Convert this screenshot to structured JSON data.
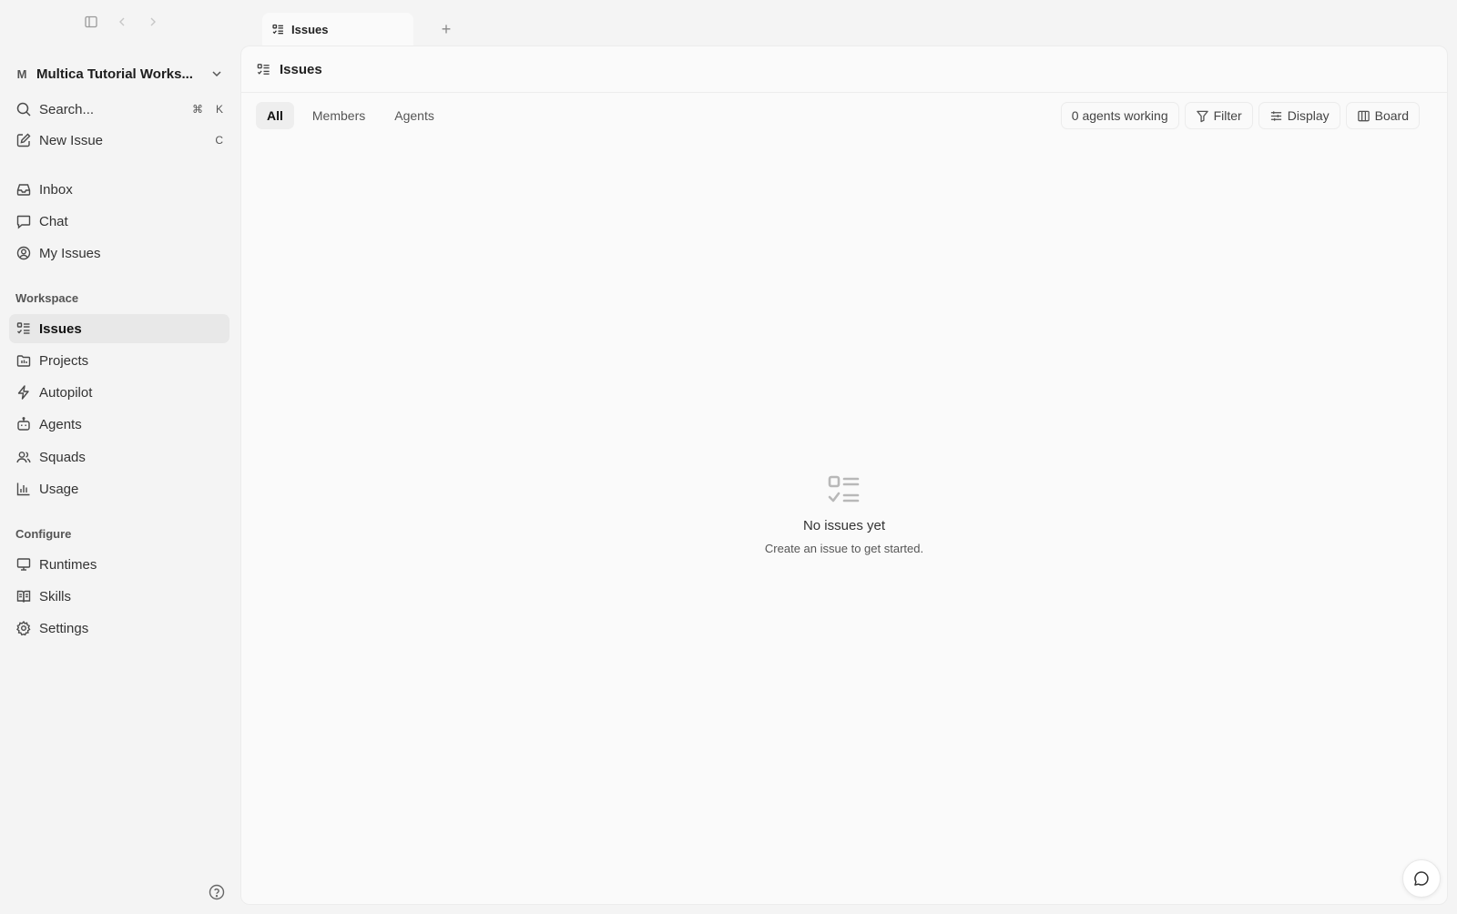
{
  "tabs": [
    {
      "label": "Issues",
      "icon": "issues-list-icon"
    }
  ],
  "sidebar": {
    "workspace": {
      "initial": "M",
      "name": "Multica Tutorial Works..."
    },
    "search": {
      "label": "Search...",
      "shortcut_mod": "⌘",
      "shortcut_key": "K"
    },
    "new_issue": {
      "label": "New Issue",
      "shortcut": "C"
    },
    "primary": [
      {
        "label": "Inbox",
        "icon": "inbox-icon"
      },
      {
        "label": "Chat",
        "icon": "chat-bubble-icon"
      },
      {
        "label": "My Issues",
        "icon": "user-circle-icon"
      }
    ],
    "workspace_section": {
      "label": "Workspace",
      "items": [
        {
          "label": "Issues",
          "icon": "issues-list-icon",
          "active": true
        },
        {
          "label": "Projects",
          "icon": "folder-icon"
        },
        {
          "label": "Autopilot",
          "icon": "lightning-icon"
        },
        {
          "label": "Agents",
          "icon": "bot-icon"
        },
        {
          "label": "Squads",
          "icon": "users-icon"
        },
        {
          "label": "Usage",
          "icon": "bar-chart-icon"
        }
      ]
    },
    "configure_section": {
      "label": "Configure",
      "items": [
        {
          "label": "Runtimes",
          "icon": "monitor-icon"
        },
        {
          "label": "Skills",
          "icon": "book-icon"
        },
        {
          "label": "Settings",
          "icon": "gear-icon"
        }
      ]
    }
  },
  "main": {
    "title": "Issues",
    "scope_tabs": [
      "All",
      "Members",
      "Agents"
    ],
    "active_scope": "All",
    "agents_status": "0 agents working",
    "buttons": {
      "filter": "Filter",
      "display": "Display",
      "board": "Board"
    },
    "empty_state": {
      "title": "No issues yet",
      "subtitle": "Create an issue to get started."
    }
  },
  "colors": {
    "sidebar_bg": "#f4f4f4",
    "panel_bg": "#fafafa",
    "active_item_bg": "#e8e8e8"
  }
}
